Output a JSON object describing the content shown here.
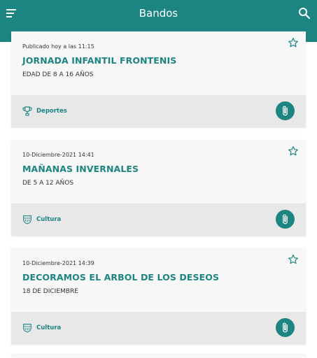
{
  "appbar": {
    "title": "Bandos",
    "menu_icon": "hamburger-menu-icon",
    "search_icon": "search-icon"
  },
  "colors": {
    "primary": "#1c8582",
    "card_background": "#f7f7f7",
    "card_footer": "#e8e8e8",
    "text": "#333333"
  },
  "cards": [
    {
      "date": "Publicado hoy a las 11:15",
      "title": "JORNADA INFANTIL FRONTENIS",
      "subtitle": "EDAD DE 8 A 16 AÑOS",
      "category": "Deportes",
      "category_icon": "trophy-icon"
    },
    {
      "date": "10-Diciembre-2021 14:41",
      "title": "MAÑANAS INVERNALES",
      "subtitle": "DE 5 A 12 AÑOS",
      "category": "Cultura",
      "category_icon": "culture-emblem-icon"
    },
    {
      "date": "10-Diciembre-2021 14:39",
      "title": "DECORAMOS EL ARBOL DE LOS DESEOS",
      "subtitle": "18 DE DICIEMBRE",
      "category": "Cultura",
      "category_icon": "culture-emblem-icon"
    }
  ]
}
